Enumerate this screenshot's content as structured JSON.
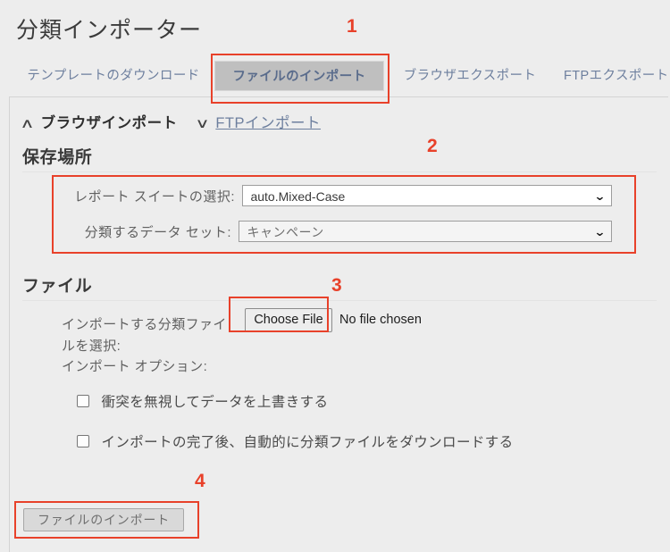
{
  "header": {
    "title": "分類インポーター"
  },
  "tabs": [
    {
      "label": "テンプレートのダウンロード",
      "active": false
    },
    {
      "label": "ファイルのインポート",
      "active": true
    },
    {
      "label": "ブラウザエクスポート",
      "active": false
    },
    {
      "label": "FTPエクスポート",
      "active": false
    }
  ],
  "mode_switch": {
    "collapse_icon": "chevron-up-icon",
    "collapse_glyph": "∧",
    "active_label": "ブラウザインポート",
    "expand_icon": "chevron-down-icon",
    "expand_glyph": "∨",
    "link_label": "FTPインポート"
  },
  "sections": {
    "storage": {
      "heading": "保存場所",
      "fields": [
        {
          "label": "レポート スイートの選択:",
          "value": "auto.Mixed-Case",
          "caret": "⌄"
        },
        {
          "label": "分類するデータ セット:",
          "value": "キャンペーン",
          "caret": "⌄"
        }
      ]
    },
    "file": {
      "heading": "ファイル",
      "file_label": "インポートする分類ファイルを選択:",
      "choose_button": "Choose File",
      "no_file_text": "No file chosen",
      "options_label": "インポート オプション:",
      "checkboxes": [
        {
          "label": "衝突を無視してデータを上書きする",
          "checked": false
        },
        {
          "label": "インポートの完了後、自動的に分類ファイルをダウンロードする",
          "checked": false
        }
      ]
    }
  },
  "submit": {
    "label": "ファイルのインポート"
  },
  "annotations": [
    {
      "number": "1"
    },
    {
      "number": "2"
    },
    {
      "number": "3"
    },
    {
      "number": "4"
    }
  ],
  "colors": {
    "annotation_red": "#e8412a",
    "tab_link": "#6d7f9e",
    "active_tab_bg": "#bfbfbf",
    "page_bg": "#ededed"
  }
}
